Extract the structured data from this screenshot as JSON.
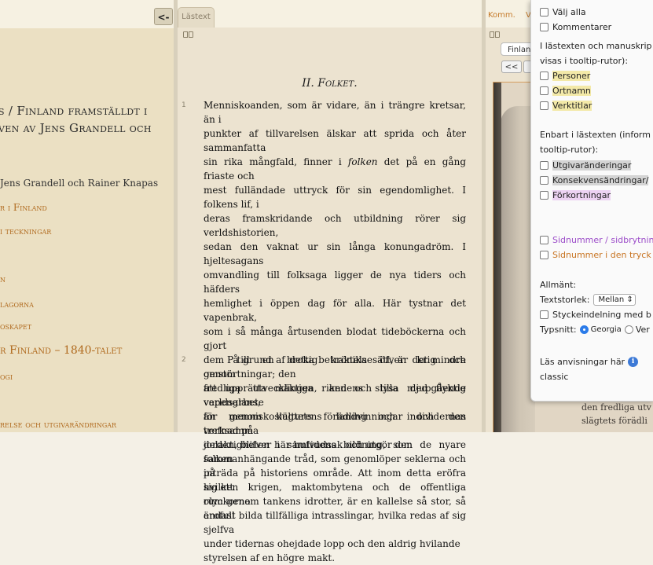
{
  "left_panel": {
    "back_button": "<-",
    "title_lines": [
      "s / Finland framställdt i",
      "ven av Jens Grandell och"
    ],
    "author": "Jens Grandell och Rainer Knapas",
    "toc_links": [
      {
        "label": "r i Finland",
        "top": 0
      },
      {
        "label": "i teckningar"
      },
      {
        "label": "n"
      },
      {
        "label": "lagorna"
      },
      {
        "label": "oskapet"
      },
      {
        "label": "r Finland – 1840-talet"
      },
      {
        "label": "ogi"
      },
      {
        "label": "relse och utgivarändringar"
      }
    ]
  },
  "middle_panel": {
    "tab_label": "Lästext",
    "chapter_title": "II. Folket.",
    "paragraphs": [
      {
        "number": "1",
        "lines": [
          "Menniskoanden, som är vidare, än i trängre kretsar, än i",
          "punkter af tillvarelsen älskar att sprida och åter sammanfatta",
          "sin rika mångfald, finner i folken det på en gång friaste och",
          "mest fulländade uttryck för sin egendomlighet. I folkens lif, i",
          "deras framskridande och utbildning rörer sig verldshistorien,",
          "sedan den vaknat ur sin långa konungadröm. I hjeltesagans",
          "omvandling till folksaga ligger de nya tiders och häfders",
          "hemlighet i öppen dag för alla. Här tystnar det vapenbrak,",
          "som i så många årtusenden blodat tideböckerna och gjort",
          "dem till en brokig krönika öfver krig och omstörtningar; den",
          "fredliga utvecklingen, andens stilla djupgående verldsarbete",
          "för menniskoslägtets förädling och individernas trefnad på",
          "jorden, blifver här hufvudsak och utgör den",
          "sammanhängande tråd, som genomlöper seklerna och på",
          "hvilken krigen, maktombytena och de offentliga olyckorna",
          "endast bilda tillfälliga intrasslingar, hvilka redas af sig sjelfva",
          "under tidernas ohejdade lopp och den aldrig hvilande",
          "styrelsen af en högre makt."
        ]
      },
      {
        "number": "2",
        "lines": [
          "På grund af detta betraktelsesätt, är det mindre genom",
          "att upprätta mäktiga riken och lysa med flyktig vapenglans,",
          "än genom kulturens landvinningar och den verksamma",
          "delaktigheten i samtidens bildning, som de nyare folken",
          "inträda på historiens område. Att inom detta eröfra sig ett",
          "rum genom tankens idrotter, är en kallelse så stor, så ärofull"
        ]
      }
    ]
  },
  "right_panel": {
    "comments_label": "Komm.",
    "comments_label2": "V",
    "select_value": "Finlan",
    "prev_button": "<<",
    "facsimile_text": [
      "den fredliga utv",
      "slägtets förädli"
    ]
  },
  "popup": {
    "select_all": "Välj alla",
    "comments": "Kommentarer",
    "tooltip_heading": [
      "I lästexten och manuskrip",
      "visas i tooltip-rutor):"
    ],
    "persons": "Personer",
    "places": "Ortnamn",
    "works": "Verktitlar",
    "readingtext_heading": [
      "Enbart i lästexten (inform",
      "tooltip-rutor):"
    ],
    "editor_changes": "Utgivaränderingar",
    "consistency_changes": "Konsekvensändringar/",
    "abbreviations": "Förkortningar",
    "page_numbers": "Sidnummer / sidbrytnin",
    "page_numbers_print": "Sidnummer i den tryck",
    "general": "Allmänt:",
    "font_size_label": "Textstorlek:",
    "font_size_value": "Mellan",
    "paragraph_label": "Styckeindelning med b",
    "font_label": "Typsnitt:",
    "font_option1": "Georgia",
    "font_option2": "Ver",
    "instructions": "Läs anvisningar här",
    "info_glyph": "i",
    "classic": "classic"
  }
}
